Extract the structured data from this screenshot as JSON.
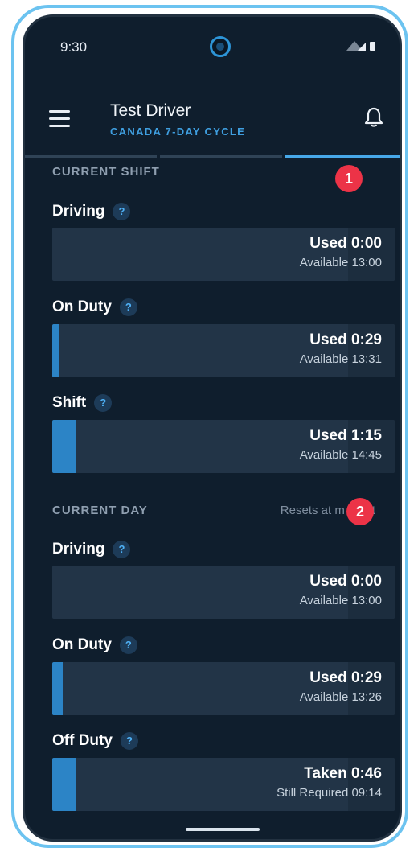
{
  "status": {
    "time": "9:30"
  },
  "header": {
    "title": "Test Driver",
    "subtitle": "CANADA 7-DAY CYCLE"
  },
  "current_shift": {
    "section_title": "CURRENT SHIFT",
    "badge": "1",
    "items": [
      {
        "label": "Driving",
        "used": "Used 0:00",
        "available": "Available 13:00",
        "fill": 0.0
      },
      {
        "label": "On Duty",
        "used": "Used 0:29",
        "available": "Available 13:31",
        "fill": 0.02
      },
      {
        "label": "Shift",
        "used": "Used 1:15",
        "available": "Available 14:45",
        "fill": 0.07
      }
    ]
  },
  "current_day": {
    "section_title": "CURRENT DAY",
    "resets_text": "Resets at m",
    "resets_tail": "t",
    "badge": "2",
    "items": [
      {
        "label": "Driving",
        "used": "Used 0:00",
        "available": "Available 13:00",
        "fill": 0.0
      },
      {
        "label": "On Duty",
        "used": "Used 0:29",
        "available": "Available 13:26",
        "fill": 0.03
      },
      {
        "label": "Off Duty",
        "used": "Taken 0:46",
        "available": "Still Required 09:14",
        "fill": 0.07
      }
    ]
  },
  "help_glyph": "?",
  "colors": {
    "accent": "#47a8e8",
    "bar_fill": "#2c84c6",
    "badge": "#ec3347",
    "background": "#0f1e2d"
  }
}
